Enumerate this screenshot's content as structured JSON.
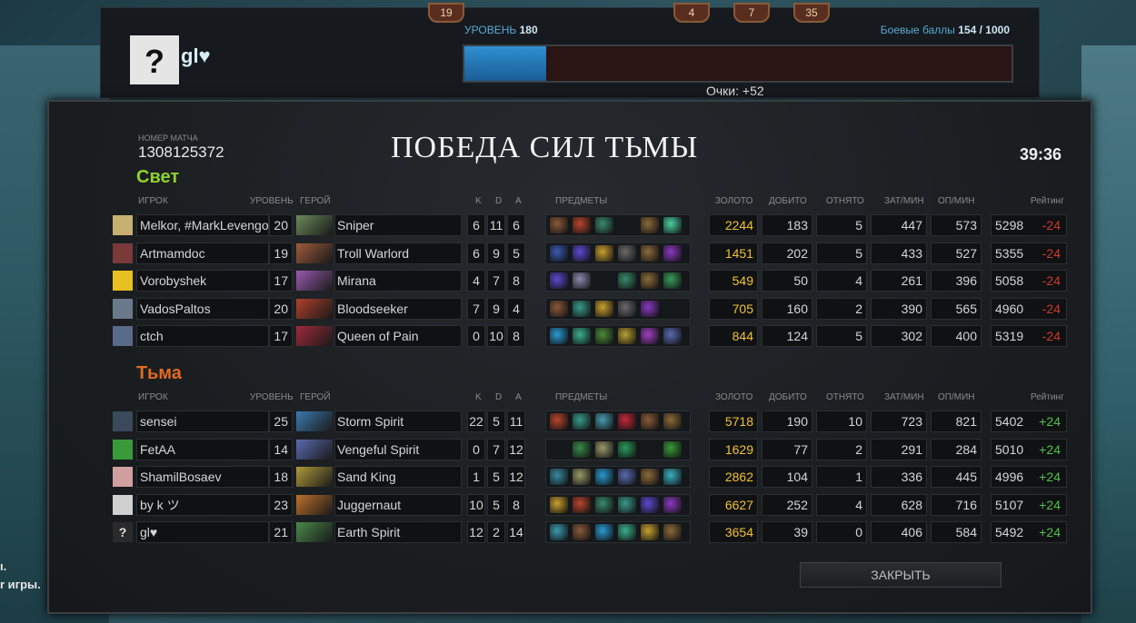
{
  "background_text": [
    "ı.",
    "r игры."
  ],
  "top_badges": [
    "19",
    "4",
    "7",
    "35"
  ],
  "profile": {
    "avatar_glyph": "?",
    "name": "gl♥",
    "level_label": "УРОВЕНЬ",
    "level": "180",
    "battle_label": "Боевые баллы",
    "battle_points": "154 / 1000",
    "xp_fraction": 0.15,
    "points_text": "Очки: +52"
  },
  "match": {
    "number_label": "НОМЕР МАТЧА",
    "number": "1308125372",
    "result": "ПОБЕДА СИЛ ТЬМЫ",
    "duration": "39:36"
  },
  "headers": {
    "player": "ИГРОК",
    "level": "УРОВЕНЬ",
    "hero": "ГЕРОЙ",
    "k": "K",
    "d": "D",
    "a": "A",
    "items": "ПРЕДМЕТЫ",
    "gold": "ЗОЛОТО",
    "last_hits": "ДОБИТО",
    "denies": "ОТНЯТО",
    "gpm": "ЗАТ/МИН",
    "xpm": "ОП/МИН",
    "rating": "Рейтинг"
  },
  "teams": [
    {
      "name": "Свет",
      "color": "#8fd12f",
      "players": [
        {
          "name": "Melkor, #MarkLevengo",
          "level": "20",
          "hero": "Sniper",
          "k": "6",
          "d": "11",
          "a": "6",
          "gold": "2244",
          "lh": "183",
          "dn": "5",
          "gpm": "447",
          "xpm": "573",
          "rating": "5298",
          "change": "-24",
          "avatar_color": "#c8b070",
          "hero_color": "#6b8c5a",
          "items": [
            "#8a5a3a",
            "#b8452e",
            "#3a8a6a",
            "",
            "#8a6a3a",
            "#4ad0a0"
          ]
        },
        {
          "name": "Artmamdoc",
          "level": "19",
          "hero": "Troll Warlord",
          "k": "6",
          "d": "9",
          "a": "5",
          "gold": "1451",
          "lh": "202",
          "dn": "5",
          "gpm": "433",
          "xpm": "527",
          "rating": "5355",
          "change": "-24",
          "avatar_color": "#7a3a3a",
          "hero_color": "#a05a3a",
          "items": [
            "#3a5ab0",
            "#5a4ad0",
            "#c8a030",
            "#6a6a6a",
            "#8a6a3a",
            "#8a3ac0"
          ]
        },
        {
          "name": "Vorobyshek",
          "level": "17",
          "hero": "Mirana",
          "k": "4",
          "d": "7",
          "a": "8",
          "gold": "549",
          "lh": "50",
          "dn": "4",
          "gpm": "261",
          "xpm": "396",
          "rating": "5058",
          "change": "-24",
          "avatar_color": "#e8c020",
          "hero_color": "#9a5ab0",
          "items": [
            "#5a4ad0",
            "#8a8ab0",
            "",
            "#3a8a6a",
            "#8a6a3a",
            "#3a9a5a"
          ]
        },
        {
          "name": "VadosPaltos",
          "level": "20",
          "hero": "Bloodseeker",
          "k": "7",
          "d": "9",
          "a": "4",
          "gold": "705",
          "lh": "160",
          "dn": "2",
          "gpm": "390",
          "xpm": "565",
          "rating": "4960",
          "change": "-24",
          "avatar_color": "#6a7a8a",
          "hero_color": "#b0402a",
          "items": [
            "#8a5a3a",
            "#3a9a8a",
            "#c8a030",
            "#6a6a6a",
            "#8a3ac0",
            ""
          ]
        },
        {
          "name": "ctch",
          "level": "17",
          "hero": "Queen of Pain",
          "k": "0",
          "d": "10",
          "a": "8",
          "gold": "844",
          "lh": "124",
          "dn": "5",
          "gpm": "302",
          "xpm": "400",
          "rating": "5319",
          "change": "-24",
          "avatar_color": "#5a6a8a",
          "hero_color": "#a02a3a",
          "items": [
            "#2a9ad0",
            "#3ab08a",
            "#4a8a3a",
            "#b8a030",
            "#a040c0",
            "#5a6ab0"
          ]
        }
      ]
    },
    {
      "name": "Тьма",
      "color": "#e06a20",
      "players": [
        {
          "name": "sensei",
          "level": "25",
          "hero": "Storm Spirit",
          "k": "22",
          "d": "5",
          "a": "11",
          "gold": "5718",
          "lh": "190",
          "dn": "10",
          "gpm": "723",
          "xpm": "821",
          "rating": "5402",
          "change": "+24",
          "avatar_color": "#3a4a5a",
          "hero_color": "#3a7ab0",
          "items": [
            "#b8452e",
            "#3a9a8a",
            "#4a9ab0",
            "#c02a3a",
            "#8a5a3a",
            "#8a6a3a"
          ]
        },
        {
          "name": "FetAA",
          "level": "14",
          "hero": "Vengeful Spirit",
          "k": "0",
          "d": "7",
          "a": "12",
          "gold": "1629",
          "lh": "77",
          "dn": "2",
          "gpm": "291",
          "xpm": "284",
          "rating": "5010",
          "change": "+24",
          "avatar_color": "#3a9a3a",
          "hero_color": "#5a6ab0",
          "items": [
            "",
            "#3a8a4a",
            "#9a9a6a",
            "#2a9a5a",
            "",
            "#3a9a3a"
          ]
        },
        {
          "name": "ShamilBosaev",
          "level": "18",
          "hero": "Sand King",
          "k": "1",
          "d": "5",
          "a": "12",
          "gold": "2862",
          "lh": "104",
          "dn": "1",
          "gpm": "336",
          "xpm": "445",
          "rating": "4996",
          "change": "+24",
          "avatar_color": "#d0a0a0",
          "hero_color": "#b09a3a",
          "items": [
            "#3a8aa0",
            "#9a9a6a",
            "#2a9ad0",
            "#5a6ab0",
            "#8a6a3a",
            "#3ab0c0"
          ]
        },
        {
          "name": "by k ツ",
          "level": "23",
          "hero": "Juggernaut",
          "k": "10",
          "d": "5",
          "a": "8",
          "gold": "6627",
          "lh": "252",
          "dn": "4",
          "gpm": "628",
          "xpm": "716",
          "rating": "5107",
          "change": "+24",
          "avatar_color": "#d0d0d0",
          "hero_color": "#c0702a",
          "items": [
            "#c8a030",
            "#b8452e",
            "#3a8a6a",
            "#3a9a8a",
            "#5a4ad0",
            "#8a3ac0"
          ]
        },
        {
          "name": "gl♥",
          "level": "21",
          "hero": "Earth Spirit",
          "k": "12",
          "d": "2",
          "a": "14",
          "gold": "3654",
          "lh": "39",
          "dn": "0",
          "gpm": "406",
          "xpm": "584",
          "rating": "5492",
          "change": "+24",
          "avatar_color": "#2a2a2a",
          "avatar_glyph": "?",
          "hero_color": "#4a8a4a",
          "items": [
            "#3a9ab0",
            "#8a5a3a",
            "#2a9ad0",
            "#3ab08a",
            "#c8a030",
            "#8a6a3a"
          ]
        }
      ]
    }
  ],
  "close_label": "ЗАКРЫТЬ"
}
